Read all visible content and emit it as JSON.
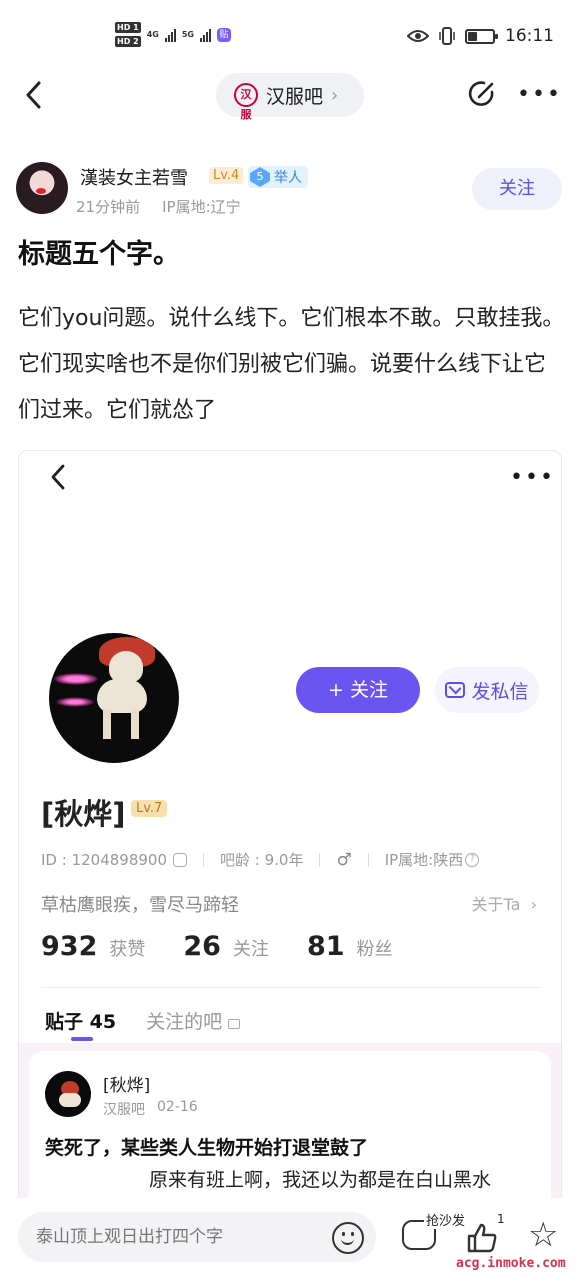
{
  "status_bar": {
    "hd1": "HD 1",
    "hd2": "HD 2",
    "net1": "4G",
    "net2": "5G",
    "app_badge": "贴",
    "time": "16:11"
  },
  "nav": {
    "forum_name": "汉服吧",
    "forum_logo_text": "汉服"
  },
  "post": {
    "author_name": "漢装女主若雪",
    "level": "Lv.4",
    "ju_level": "5",
    "ju_label": "举人",
    "time": "21分钟前",
    "ip": "IP属地:辽宁",
    "follow_label": "关注",
    "title": "标题五个字。",
    "body": "它们you问题。说什么线下。它们根本不敢。只敢挂我。它们现实啥也不是你们别被它们骗。说要什么线下让它们过来。它们就怂了"
  },
  "profile": {
    "follow_label": "+ 关注",
    "message_label": "发私信",
    "name": "[秋烨]",
    "level": "Lv.7",
    "id_text": "ID : 1204898900",
    "age_text": "吧龄 : 9.0年",
    "ip_text": "IP属地:陕西",
    "bio": "草枯鹰眼疾，雪尽马蹄轻",
    "about": "关于Ta",
    "stats": [
      {
        "num": "932",
        "label": "获赞"
      },
      {
        "num": "26",
        "label": "关注"
      },
      {
        "num": "81",
        "label": "粉丝"
      }
    ],
    "tab_posts": "贴子 45",
    "tab_forums": "关注的吧",
    "feed": {
      "name": "[秋烨]",
      "forum": "汉服吧",
      "date": "02-16",
      "title": "笑死了，某些类人生物开始打退堂鼓了",
      "body": "原来有班上啊，我还以为都是在白山黑水"
    }
  },
  "bottom": {
    "reply_placeholder": "泰山顶上观日出打四个字",
    "grab_sofa": "抢沙发",
    "like_count": "1",
    "watermark": "acg.inmoke.com"
  }
}
